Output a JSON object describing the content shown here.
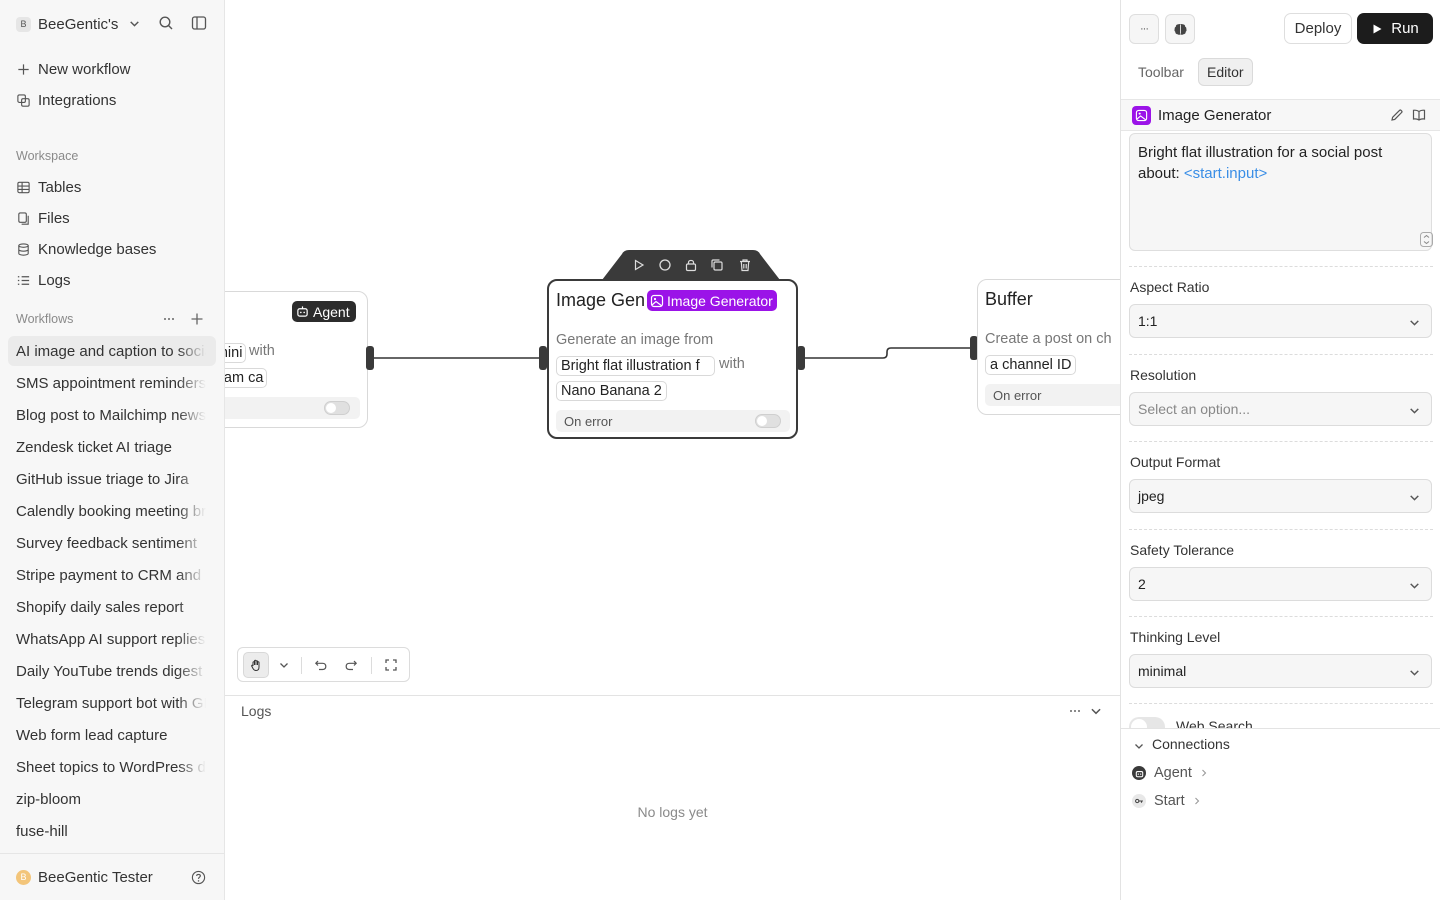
{
  "sidebar": {
    "workspace_initial": "B",
    "workspace_name": "BeeGentic's",
    "nav": [
      {
        "label": "New workflow",
        "icon": "plus-icon"
      },
      {
        "label": "Integrations",
        "icon": "integrations-icon"
      }
    ],
    "workspace_section": "Workspace",
    "workspace_items": [
      {
        "label": "Tables",
        "icon": "table-icon"
      },
      {
        "label": "Files",
        "icon": "files-icon"
      },
      {
        "label": "Knowledge bases",
        "icon": "database-icon"
      },
      {
        "label": "Logs",
        "icon": "list-icon"
      }
    ],
    "workflows_section": "Workflows",
    "workflows": [
      "AI image and caption to social",
      "SMS appointment reminders",
      "Blog post to Mailchimp newsletter",
      "Zendesk ticket AI triage",
      "GitHub issue triage to Jira",
      "Calendly booking meeting brief",
      "Survey feedback sentiment",
      "Stripe payment to CRM and",
      "Shopify daily sales report",
      "WhatsApp AI support replies",
      "Daily YouTube trends digest",
      "Telegram support bot with GPT",
      "Web form lead capture",
      "Sheet topics to WordPress drafts",
      "zip-bloom",
      "fuse-hill"
    ],
    "active_workflow_index": 0,
    "user_initial": "B",
    "user_name": "BeeGentic Tester"
  },
  "canvas": {
    "agent_node": {
      "badge": "Agent",
      "chip_model": "-mini",
      "with_text": "with",
      "chip_tools": "gram ca"
    },
    "image_node": {
      "title": "Image Gen",
      "badge": "Image Generator",
      "subtitle": "Generate an image from",
      "chip_prompt": "Bright flat illustration f",
      "with_text": "with",
      "chip_model": "Nano Banana 2",
      "on_error": "On error"
    },
    "buffer_node": {
      "title": "Buffer",
      "subtitle": "Create a post on ch",
      "chip_channel": "a channel ID",
      "on_error": "On error"
    }
  },
  "logs": {
    "title": "Logs",
    "empty_text": "No logs yet"
  },
  "panel": {
    "more_label": "···",
    "deploy_label": "Deploy",
    "run_label": "Run",
    "tabs": [
      {
        "label": "Toolbar",
        "active": false
      },
      {
        "label": "Editor",
        "active": true
      }
    ],
    "block_title": "Image Generator",
    "prompt_text": "Bright flat illustration for a social post about: ",
    "prompt_ref": "<start.input>",
    "fields": [
      {
        "label": "Aspect Ratio",
        "value": "1:1",
        "placeholder": false
      },
      {
        "label": "Resolution",
        "value": "Select an option...",
        "placeholder": true
      },
      {
        "label": "Output Format",
        "value": "jpeg",
        "placeholder": false
      },
      {
        "label": "Safety Tolerance",
        "value": "2",
        "placeholder": false
      },
      {
        "label": "Thinking Level",
        "value": "minimal",
        "placeholder": false
      }
    ],
    "web_search_label": "Web Search",
    "connections_title": "Connections",
    "connections": [
      {
        "label": "Agent",
        "icon": "agent-icon"
      },
      {
        "label": "Start",
        "icon": "start-icon"
      }
    ]
  },
  "colors": {
    "accent_purple": "#9b13e8",
    "reference_blue": "#3a8ee6",
    "run_button": "#1c1c1c"
  }
}
